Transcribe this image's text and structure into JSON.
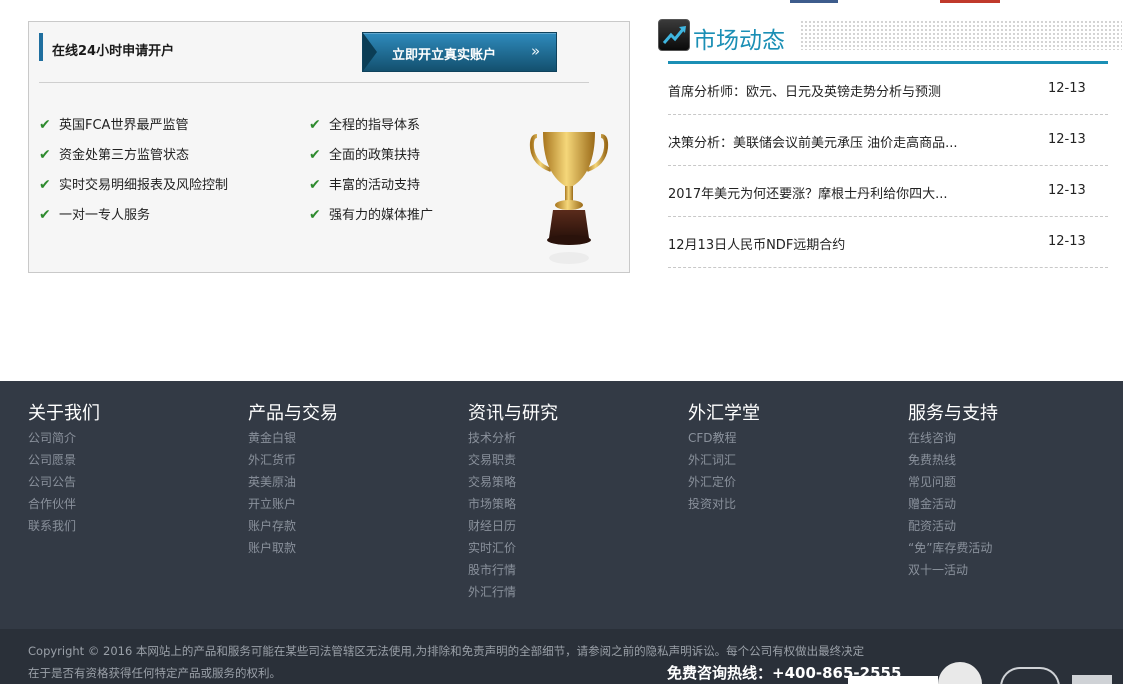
{
  "panel": {
    "title": "在线24小时申请开户",
    "button_label": "立即开立真实账户",
    "button_chevron": "»",
    "features_left": [
      "英国FCA世界最严监管",
      "资金处第三方监管状态",
      "实时交易明细报表及风险控制",
      "一对一专人服务"
    ],
    "features_right": [
      "全程的指导体系",
      "全面的政策扶持",
      "丰富的活动支持",
      "强有力的媒体推广"
    ],
    "check_glyph": "✔"
  },
  "market": {
    "title": "市场动态",
    "news": [
      {
        "title": "首席分析师：欧元、日元及英镑走势分析与预测",
        "date": "12-13"
      },
      {
        "title": "决策分析：美联储会议前美元承压 油价走高商品...",
        "date": "12-13"
      },
      {
        "title": "2017年美元为何还要涨？摩根士丹利给你四大...",
        "date": "12-13"
      },
      {
        "title": "12月13日人民币NDF远期合约",
        "date": "12-13"
      }
    ]
  },
  "footer": {
    "columns": [
      {
        "heading": "关于我们",
        "links": [
          "公司简介",
          "公司愿景",
          "公司公告",
          "合作伙伴",
          "联系我们"
        ]
      },
      {
        "heading": "产品与交易",
        "links": [
          "黄金白银",
          "外汇货币",
          "英美原油",
          "开立账户",
          "账户存款",
          "账户取款"
        ]
      },
      {
        "heading": "资讯与研究",
        "links": [
          "技术分析",
          "交易职责",
          "交易策略",
          "市场策略",
          "财经日历",
          "实时汇价",
          "股市行情",
          "外汇行情"
        ]
      },
      {
        "heading": "外汇学堂",
        "links": [
          "CFD教程",
          "外汇词汇",
          "外汇定价",
          "投资对比"
        ]
      },
      {
        "heading": "服务与支持",
        "links": [
          "在线咨询",
          "免费热线",
          "常见问题",
          "赠金活动",
          "配资活动",
          "“免”库存费活动",
          "双十一活动"
        ]
      }
    ],
    "copyright_line1": "Copyright © 2016 本网站上的产品和服务可能在某些司法管辖区无法使用,为排除和免责声明的全部细节，请参阅之前的隐私声明诉讼。每个公司有权做出最终决定",
    "copyright_line2": "在于是否有资格获得任何特定产品或服务的权利。",
    "hotline": "免费咨询热线：+400-865-2555"
  },
  "colors": {
    "accent_blue": "#1b8fb5",
    "check_green": "#2e8b2e",
    "footer_bg": "#333a45",
    "copyright_bg": "#2a3039"
  },
  "icons": [
    "check-icon",
    "chevron-right-icon",
    "trophy-icon",
    "trend-chart-icon"
  ]
}
